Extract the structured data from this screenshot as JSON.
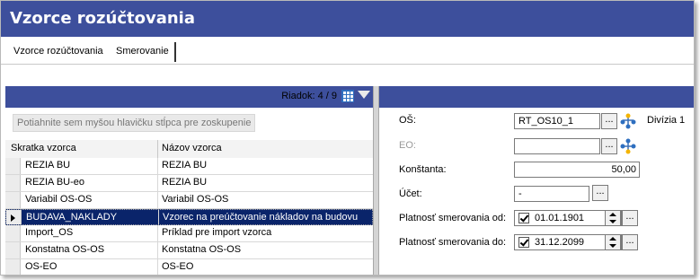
{
  "window": {
    "title": "Vzorce rozúčtovania"
  },
  "tabs": [
    {
      "label": "Vzorce rozúčtovania",
      "active": false
    },
    {
      "label": "Smerovanie",
      "active": true
    }
  ],
  "grid": {
    "row_counter": "Riadok: 4 / 9",
    "group_hint": "Potiahnite sem myšou hlavičku stĺpca pre zoskupenie",
    "columns": [
      "Skratka vzorca",
      "Názov vzorca"
    ],
    "rows": [
      {
        "code": "REZIA BU",
        "name": "REZIA BU"
      },
      {
        "code": "REZIA BU-eo",
        "name": "REZIA BU"
      },
      {
        "code": "Variabil OS-OS",
        "name": "Variabil OS-OS"
      },
      {
        "code": "BUDAVA_NAKLADY",
        "name": "Vzorec na preúčtovanie nákladov na budovu"
      },
      {
        "code": "Import_OS",
        "name": "Príklad pre import vzorca"
      },
      {
        "code": "Konstatna OS-OS",
        "name": "Konstatna OS-OS"
      },
      {
        "code": "OS-EO",
        "name": "OS-EO"
      }
    ],
    "selected_index": 3
  },
  "form": {
    "os_label": "OŠ:",
    "os_value": "RT_OS10_1",
    "os_division": "Divízia 1",
    "eo_label": "EO:",
    "eo_value": "",
    "konstanta_label": "Konštanta:",
    "konstanta_value": "50,00",
    "ucet_label": "Účet:",
    "ucet_value": "-",
    "platnost_od_label": "Platnosť smerovania od:",
    "platnost_od_value": "01.01.1901",
    "platnost_do_label": "Platnosť smerovania do:",
    "platnost_do_value": "31.12.2099",
    "browse_label": "...",
    "accent": "#3d4f9c",
    "selection_color": "#0a246a"
  }
}
